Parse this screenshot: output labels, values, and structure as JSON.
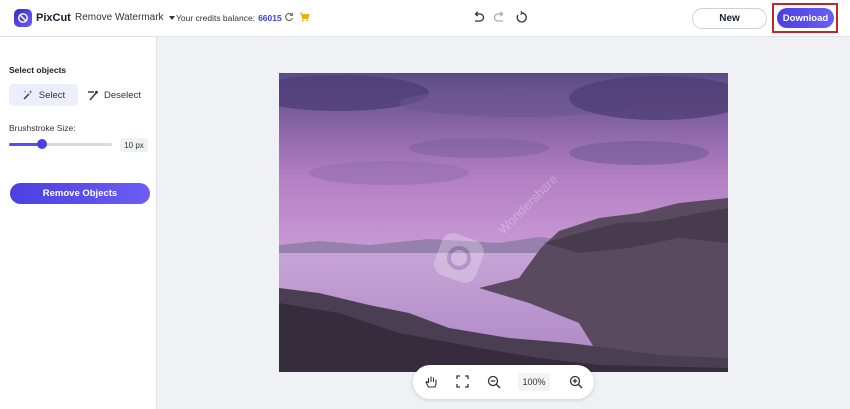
{
  "app": {
    "brand": "PixCut",
    "mode": "Remove Watermark"
  },
  "credits": {
    "label": "Your credits balance:",
    "value": "66015"
  },
  "header": {
    "new_label": "New",
    "download_label": "Download"
  },
  "sidebar": {
    "section_title": "Select objects",
    "select_label": "Select",
    "deselect_label": "Deselect",
    "brush_label": "Brushstroke Size:",
    "brush_value": "10 px",
    "brush_level": 0.32,
    "remove_label": "Remove Objects"
  },
  "canvas": {
    "watermark_text": "Wondershare"
  },
  "zoom": {
    "value": "100%"
  },
  "colors": {
    "accent": "#4b3fe0",
    "highlight": "#c0272d"
  },
  "icons": [
    "pixcut-logo-icon",
    "chevron-down-icon",
    "refresh-icon",
    "cart-icon",
    "undo-icon",
    "redo-icon",
    "reset-icon",
    "select-wand-icon",
    "deselect-brush-icon",
    "hand-icon",
    "fit-screen-icon",
    "zoom-out-icon",
    "zoom-in-icon"
  ]
}
